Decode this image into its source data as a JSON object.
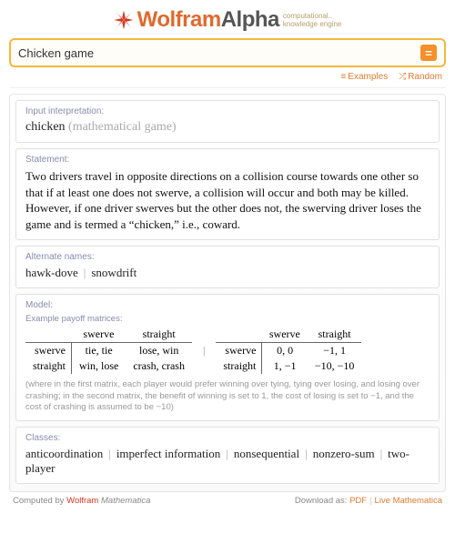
{
  "logo": {
    "word1": "Wolfram",
    "word2": "Alpha",
    "tagline1": "computational..",
    "tagline2": "knowledge engine"
  },
  "search": {
    "value": "Chicken game",
    "go": "="
  },
  "sublinks": {
    "examples": "Examples",
    "random": "Random"
  },
  "pods": {
    "interp": {
      "title": "Input interpretation:",
      "term": "chicken",
      "paren": "(mathematical game)"
    },
    "statement": {
      "title": "Statement:",
      "text": "Two drivers travel in opposite directions on a collision course towards one other so that if at least one does not swerve, a collision will occur and both may be killed. However, if one driver swerves but the other does not, the swerving driver loses the game and is termed a “chicken,” i.e., coward."
    },
    "altnames": {
      "title": "Alternate names:",
      "items": [
        "hawk-dove",
        "snowdrift"
      ]
    },
    "model": {
      "title": "Model:",
      "subtitle": "Example payoff matrices:",
      "cols": [
        "swerve",
        "straight"
      ],
      "rows": [
        "swerve",
        "straight"
      ],
      "matrixA": [
        [
          "tie, tie",
          "lose, win"
        ],
        [
          "win, lose",
          "crash, crash"
        ]
      ],
      "matrixB": [
        [
          "0, 0",
          "−1, 1"
        ],
        [
          "1, −1",
          "−10, −10"
        ]
      ],
      "note": "(where in the first matrix, each player would prefer winning over tying, tying over losing, and losing over crashing; in the second matrix, the benefit of winning is set to 1, the cost of losing is set to −1, and the cost of crashing is assumed to be −10)"
    },
    "classes": {
      "title": "Classes:",
      "items": [
        "anticoordination",
        "imperfect information",
        "nonsequential",
        "nonzero-sum",
        "two-player"
      ]
    }
  },
  "footer": {
    "computed_by": "Computed by",
    "wolfram": "Wolfram",
    "mathematica": "Mathematica",
    "download_as": "Download as:",
    "pdf": "PDF",
    "live": "Live Mathematica"
  }
}
